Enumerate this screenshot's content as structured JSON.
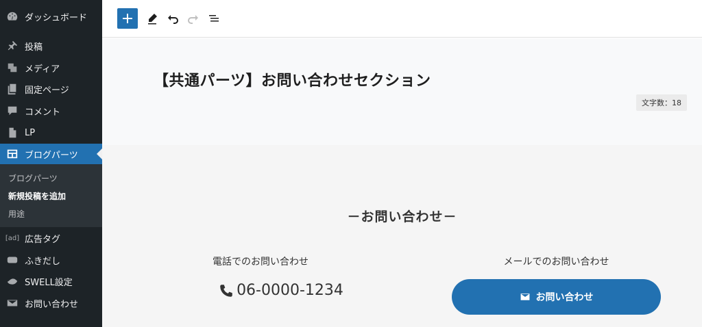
{
  "sidebar": {
    "items": [
      {
        "label": "ダッシュボード",
        "icon": "dashboard-icon"
      },
      {
        "label": "投稿",
        "icon": "pin-icon"
      },
      {
        "label": "メディア",
        "icon": "media-icon"
      },
      {
        "label": "固定ページ",
        "icon": "pages-icon"
      },
      {
        "label": "コメント",
        "icon": "comment-icon"
      },
      {
        "label": "LP",
        "icon": "document-icon"
      },
      {
        "label": "ブログパーツ",
        "icon": "blog-parts-icon"
      },
      {
        "label": "広告タグ",
        "icon": "ad-icon"
      },
      {
        "label": "ふきだし",
        "icon": "bubble-icon"
      },
      {
        "label": "SWELL設定",
        "icon": "swell-icon"
      },
      {
        "label": "お問い合わせ",
        "icon": "mail-icon"
      }
    ],
    "ad_icon_text": "[ad]",
    "submenu": [
      {
        "label": "ブログパーツ"
      },
      {
        "label": "新規投稿を追加"
      },
      {
        "label": "用途"
      }
    ]
  },
  "toolbar": {
    "buttons": [
      "add-block-icon",
      "edit-pencil-icon",
      "undo-icon",
      "redo-icon",
      "list-view-icon"
    ]
  },
  "editor": {
    "title": "【共通パーツ】お問い合わせセクション",
    "char_count": "文字数：18"
  },
  "section": {
    "heading": "－お問い合わせ－",
    "tel_label": "電話でのお問い合わせ",
    "tel_number": "06-0000-1234",
    "mail_label": "メールでのお問い合わせ",
    "mail_button": "お問い合わせ"
  },
  "colors": {
    "sidebar_bg": "#1d2327",
    "accent": "#2271b1"
  }
}
